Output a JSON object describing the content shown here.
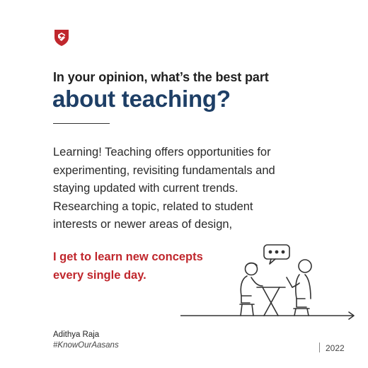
{
  "brand": {
    "logo_icon": "shield-logo-icon",
    "accent_color": "#c0272d",
    "heading_color": "#1e3f66"
  },
  "question": {
    "line1": "In your opinion, what’s the best part",
    "line2": "about teaching?"
  },
  "answer": {
    "lines": [
      "Learning! Teaching offers opportunities for",
      "experimenting, revisiting fundamentals and",
      "staying updated with current trends.",
      "Researching a topic, related to student",
      "interests or newer areas of design,"
    ]
  },
  "highlight": {
    "lines": [
      "I get to learn new concepts",
      "every single day."
    ]
  },
  "illustration": {
    "icon": "two-people-conversation-illustration"
  },
  "footer": {
    "author": "Adithya Raja",
    "hashtag": "#KnowOurAasans",
    "year": "2022"
  }
}
